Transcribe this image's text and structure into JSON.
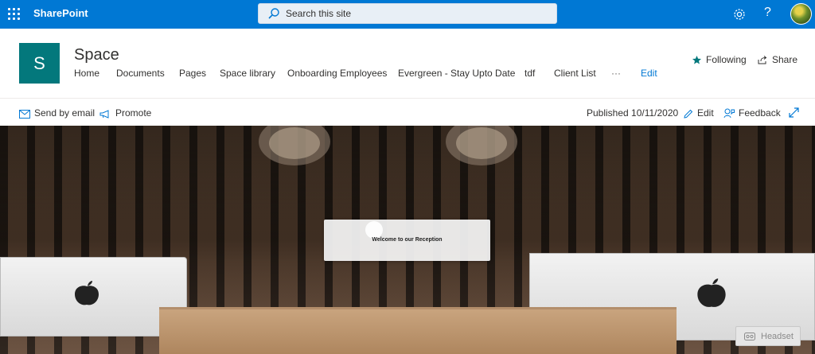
{
  "suite_bar": {
    "brand": "SharePoint",
    "search_placeholder": "Search this site",
    "help_label": "?"
  },
  "site": {
    "logo_letter": "S",
    "title": "Space",
    "nav": [
      "Home",
      "Documents",
      "Pages",
      "Space library",
      "Onboarding Employees",
      "Evergreen - Stay Upto Date",
      "tdf",
      "Client List",
      "···",
      "Edit"
    ],
    "following_label": "Following",
    "share_label": "Share"
  },
  "command_bar": {
    "send_by_email": "Send by email",
    "promote": "Promote",
    "published": "Published 10/11/2020",
    "edit": "Edit",
    "feedback": "Feedback"
  },
  "hero": {
    "welcome_text": "Welcome to our Reception",
    "headset_label": "Headset"
  },
  "colors": {
    "suite_blue": "#0078d4",
    "logo_teal": "#03787c",
    "link_blue": "#0078d4"
  },
  "icons": [
    "waffle-icon",
    "search-icon",
    "gear-icon",
    "help-icon",
    "star-icon",
    "share-icon",
    "email-icon",
    "promote-icon",
    "edit-icon",
    "feedback-icon",
    "expand-icon",
    "headset-icon"
  ]
}
